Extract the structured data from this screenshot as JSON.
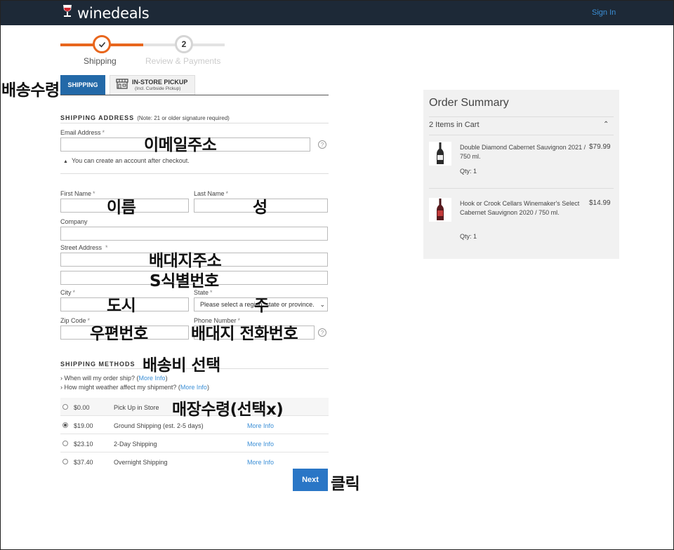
{
  "app": {
    "logo_text": "winedeals",
    "signin_label": "Sign In"
  },
  "steps": [
    {
      "number": "1",
      "label": "Shipping",
      "state": "done"
    },
    {
      "number": "2",
      "label": "Review & Payments",
      "state": "pending"
    }
  ],
  "tabs": {
    "shipping_label": "SHIPPING",
    "pickup_label": "IN-STORE PICKUP",
    "pickup_sub": "(Incl. Curbside Pickup)"
  },
  "address": {
    "section_title": "SHIPPING ADDRESS",
    "section_note": "(Note: 21 or older signature required)",
    "email_label": "Email Address",
    "email_hint": "You can create an account after checkout.",
    "first_name_label": "First Name",
    "last_name_label": "Last Name",
    "company_label": "Company",
    "street_label": "Street Address",
    "city_label": "City",
    "state_label": "State",
    "state_selected": "Please select a region, state or province.",
    "zip_label": "Zip Code",
    "phone_label": "Phone Number",
    "required_mark": "*",
    "help_glyph": "?"
  },
  "shipping_methods": {
    "section_title": "SHIPPING METHODS",
    "info1_text": "› When will my order ship? (",
    "info1_link": "More Info",
    "info1_end": ")",
    "info2_text": "› How might weather affect my shipment? (",
    "info2_link": "More Info",
    "info2_end": ")",
    "options": [
      {
        "price": "$0.00",
        "name": "Pick Up in Store",
        "more": "",
        "selected": false
      },
      {
        "price": "$19.00",
        "name": "Ground Shipping (est. 2-5 days)",
        "more": "More Info",
        "selected": true
      },
      {
        "price": "$23.10",
        "name": "2-Day Shipping",
        "more": "More Info",
        "selected": false
      },
      {
        "price": "$37.40",
        "name": "Overnight Shipping",
        "more": "More Info",
        "selected": false
      }
    ],
    "next_label": "Next"
  },
  "summary": {
    "title": "Order Summary",
    "items_count": "2 Items in Cart",
    "caret": "⌃",
    "items": [
      {
        "name": "Double Diamond Cabernet Sauvignon 2021 / 750 ml.",
        "price": "$79.99",
        "qty": "Qty: 1"
      },
      {
        "name": "Hook or Crook Cellars Winemaker's Select Cabernet Sauvignon 2020 / 750 ml.",
        "price": "$14.99",
        "qty": "Qty: 1"
      }
    ]
  },
  "annotations": {
    "shipping_tab": "배송수령",
    "email": "이메일주소",
    "first_name": "이름",
    "last_name": "성",
    "street": "배대지주소",
    "street2": "S식별번호",
    "city": "도시",
    "state": "주",
    "zip": "우편번호",
    "phone": "배대지 전화번호",
    "shipping_method": "배송비 선택",
    "pickup": "매장수령(선택x)",
    "click": "클릭"
  },
  "colors": {
    "topbar": "#1d2937",
    "accent": "#e8661d",
    "link": "#3b8fd6",
    "button": "#2a76c6"
  }
}
